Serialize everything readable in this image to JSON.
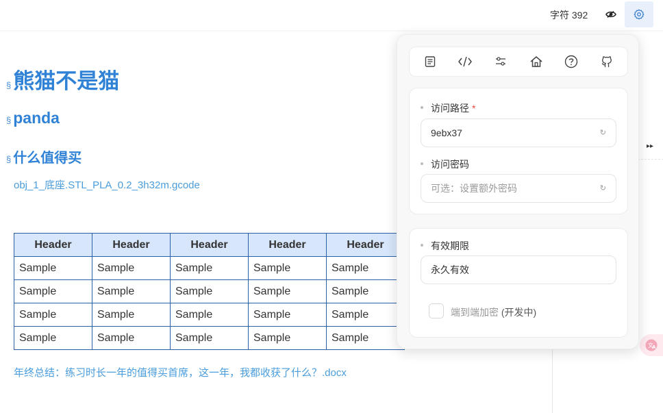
{
  "topbar": {
    "word_count": "字符 392",
    "eye_icon": "eye-icon",
    "settings_icon": "gear-icon"
  },
  "doc": {
    "anchor": "§",
    "h1": "熊猫不是猫",
    "h2": "panda",
    "h3": "什么值得买",
    "link1": "obj_1_底座.STL_PLA_0.2_3h32m.gcode",
    "table": {
      "headers": [
        "Header",
        "Header",
        "Header",
        "Header",
        "Header"
      ],
      "rows": [
        [
          "Sample",
          "Sample",
          "Sample",
          "Sample",
          "Sample"
        ],
        [
          "Sample",
          "Sample",
          "Sample",
          "Sample",
          "Sample"
        ],
        [
          "Sample",
          "Sample",
          "Sample",
          "Sample",
          "Sample"
        ],
        [
          "Sample",
          "Sample",
          "Sample",
          "Sample",
          "Sample"
        ]
      ]
    },
    "link2": "年终总结：练习时长一年的值得买首席，这一年，我都收获了什么？.docx"
  },
  "popup": {
    "icons": [
      "document-icon",
      "code-icon",
      "sliders-icon",
      "home-icon",
      "help-icon",
      "github-icon"
    ],
    "path_label": "访问路径",
    "path_required": "*",
    "path_value": "9ebx37",
    "password_label": "访问密码",
    "password_placeholder": "可选：设置额外密码",
    "expiry_label": "有效期限",
    "expiry_value": "永久有效",
    "e2e_label": "端到端加密",
    "e2e_dev": "(开发中)"
  },
  "colors": {
    "heading": "#2f82d6",
    "link": "#4a9ddc",
    "table_header_bg": "#d7e6fb",
    "table_border": "#2b5fa8",
    "gear_button_bg": "#e7f0fb"
  }
}
